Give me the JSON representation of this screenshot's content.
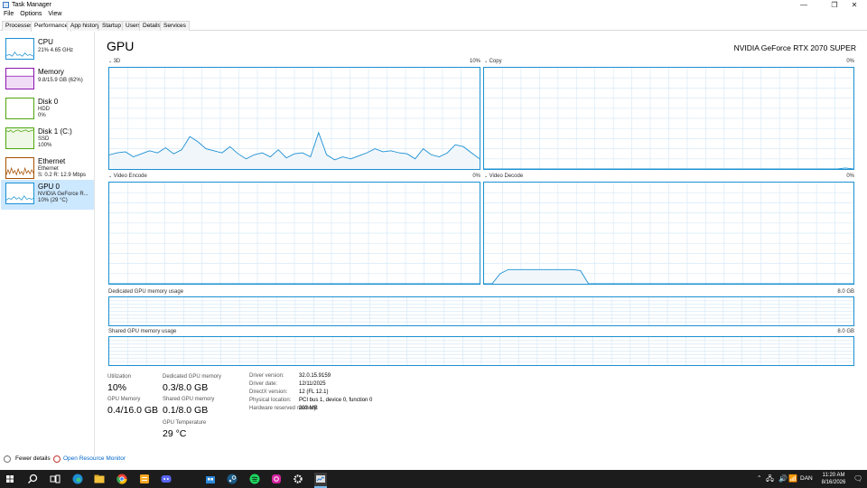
{
  "window": {
    "title": "Task Manager",
    "minimize_glyph": "—",
    "maximize_glyph": "❐",
    "close_glyph": "✕"
  },
  "menu": [
    "File",
    "Options",
    "View"
  ],
  "tabs": [
    "Processes",
    "Performance",
    "App history",
    "Startup",
    "Users",
    "Details",
    "Services"
  ],
  "active_tab": "Performance",
  "sidebar": [
    {
      "name": "CPU",
      "l1": "21% 4.65 GHz",
      "l2": "",
      "l3": "",
      "color": "#1a90d2"
    },
    {
      "name": "Memory",
      "l1": "9.8/15.9 GB (62%)",
      "l2": "",
      "l3": "",
      "color": "#8b12ae"
    },
    {
      "name": "Disk 0",
      "l1": "HDD",
      "l2": "0%",
      "l3": "",
      "color": "#4da60c"
    },
    {
      "name": "Disk 1 (C:)",
      "l1": "SSD",
      "l2": "100%",
      "l3": "",
      "color": "#4da60c"
    },
    {
      "name": "Ethernet",
      "l1": "Ethernet",
      "l2": "S: 0.2  R: 12.9 Mbps",
      "l3": "",
      "color": "#a74f01"
    },
    {
      "name": "GPU 0",
      "l1": "NVIDIA GeForce R...",
      "l2": "10% (29 °C)",
      "l3": "",
      "color": "#1a90d2"
    }
  ],
  "selected_index": 5,
  "gpu": {
    "title": "GPU",
    "model": "NVIDIA GeForce RTX 2070 SUPER",
    "engines": [
      {
        "name": "3D",
        "pct": "10%",
        "values": [
          14,
          16,
          17,
          12,
          15,
          18,
          16,
          21,
          15,
          19,
          32,
          27,
          20,
          18,
          16,
          22,
          15,
          10,
          14,
          16,
          12,
          19,
          11,
          15,
          16,
          12,
          36,
          14,
          9,
          12,
          10,
          13,
          16,
          20,
          17,
          18,
          16,
          15,
          10,
          20,
          14,
          12,
          16,
          24,
          22,
          16,
          10
        ]
      },
      {
        "name": "Copy",
        "pct": "0%",
        "values": [
          0,
          0,
          0,
          0,
          0,
          0,
          0,
          0,
          0,
          0,
          0,
          0,
          0,
          0,
          0,
          0,
          0,
          0,
          0,
          0,
          0,
          0,
          0,
          0,
          0,
          0,
          0,
          0,
          0,
          0,
          0,
          0,
          0,
          0,
          0,
          0,
          0,
          0,
          0,
          0,
          0,
          0,
          0,
          0,
          0,
          1,
          0
        ]
      },
      {
        "name": "Video Encode",
        "pct": "0%",
        "values": [
          0,
          0,
          0,
          0,
          0,
          0,
          0,
          0,
          0,
          0,
          0,
          0,
          0,
          0,
          0,
          0,
          0,
          0,
          0,
          0,
          0,
          0,
          0,
          0,
          0,
          0,
          0,
          0,
          0,
          0,
          0,
          0,
          0,
          0,
          0,
          0,
          0,
          0,
          0,
          0,
          0,
          0,
          0,
          0,
          0,
          0,
          0
        ]
      },
      {
        "name": "Video Decode",
        "pct": "0%",
        "values": [
          0,
          0,
          10,
          14,
          14,
          14,
          14,
          14,
          14,
          14,
          14,
          14,
          13,
          0,
          0,
          0,
          0,
          0,
          0,
          0,
          0,
          0,
          0,
          0,
          0,
          0,
          0,
          0,
          0,
          0,
          0,
          0,
          0,
          0,
          0,
          0,
          0,
          0,
          0,
          0,
          0,
          0,
          0,
          0,
          0,
          0,
          0
        ]
      }
    ],
    "dedicated_label": "Dedicated GPU memory usage",
    "dedicated_max": "8.0 GB",
    "shared_label": "Shared GPU memory usage",
    "shared_max": "8.0 GB",
    "stats": {
      "utilization_label": "Utilization",
      "utilization": "10%",
      "dedicated_label": "Dedicated GPU memory",
      "dedicated": "0.3/8.0 GB",
      "gpu_memory_label": "GPU Memory",
      "gpu_memory": "0.4/16.0 GB",
      "shared_label": "Shared GPU memory",
      "shared": "0.1/8.0 GB",
      "temp_label": "GPU Temperature",
      "temp": "29 °C"
    },
    "info": [
      {
        "label": "Driver version:",
        "value": "32.0.15.9159"
      },
      {
        "label": "Driver date:",
        "value": "12/11/2025"
      },
      {
        "label": "DirectX version:",
        "value": "12 (FL 12.1)"
      },
      {
        "label": "Physical location:",
        "value": "PCI bus 1, device 0, function 0"
      },
      {
        "label": "Hardware reserved memory:",
        "value": "203 MB"
      }
    ]
  },
  "footer": {
    "fewer_details": "Fewer details",
    "resource_monitor": "Open Resource Monitor"
  },
  "taskbar": {
    "icons": [
      "windows-start-icon",
      "search-icon",
      "task-view-icon",
      "edge-icon",
      "file-explorer-icon",
      "chrome-icon",
      "notes-app-icon",
      "discord-icon",
      "store-icon",
      "steam-icon",
      "spotify-icon",
      "instagram-icon",
      "settings-icon",
      "task-manager-icon"
    ],
    "lang": "DAN",
    "time": "11:20 AM",
    "date": "8/16/2026"
  }
}
